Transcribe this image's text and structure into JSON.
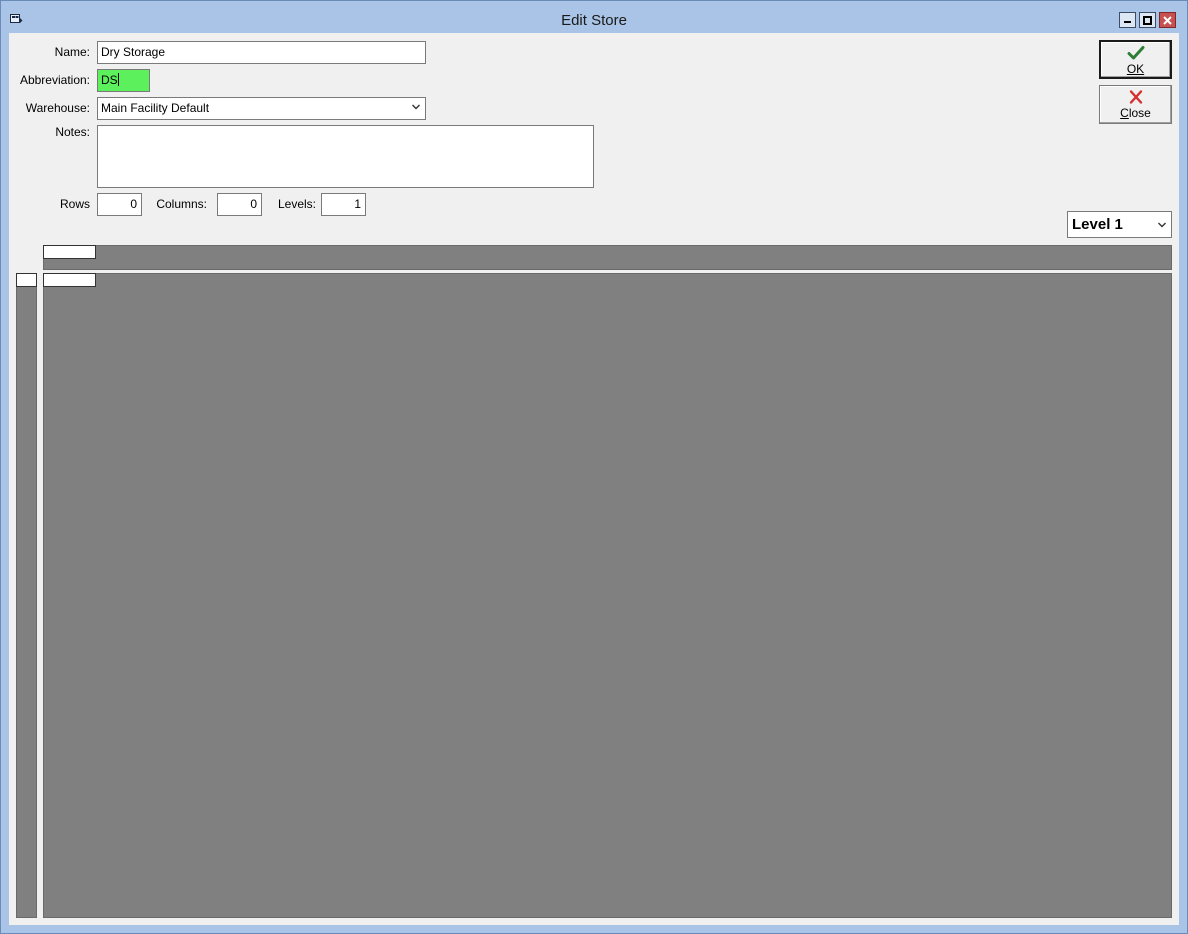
{
  "window": {
    "title": "Edit Store",
    "icons": {
      "app": "store-app-icon",
      "minimize": "minimize-icon",
      "maximize": "maximize-icon",
      "close": "close-icon"
    }
  },
  "form": {
    "name_label": "Name:",
    "name_value": "Dry Storage",
    "abbreviation_label": "Abbreviation:",
    "abbreviation_value": "DS",
    "warehouse_label": "Warehouse:",
    "warehouse_value": "Main Facility Default",
    "notes_label": "Notes:",
    "notes_value": "",
    "rows_label": "Rows",
    "rows_value": "0",
    "columns_label": "Columns:",
    "columns_value": "0",
    "levels_label": "Levels:",
    "levels_value": "1"
  },
  "buttons": {
    "ok_label": "OK",
    "ok_icon": "checkmark-icon",
    "ok_icon_color": "#2e7d32",
    "close_label": "Close",
    "close_icon": "x-icon",
    "close_icon_color": "#d32f2f"
  },
  "level_select": {
    "value": "Level 1"
  },
  "colors": {
    "titlebar": "#a9c4e6",
    "abbreviation_highlight": "#5cf05c",
    "grid_background": "#808080",
    "window_close_button": "#c75050"
  }
}
